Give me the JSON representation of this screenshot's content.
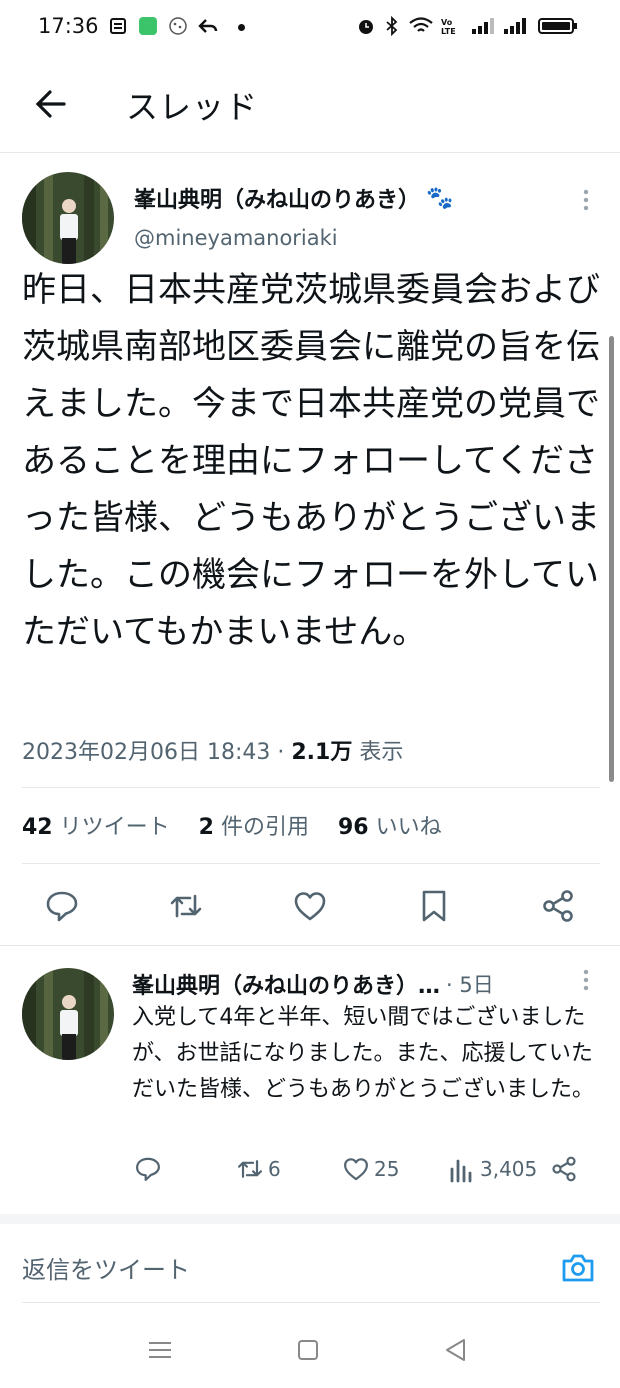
{
  "status_bar": {
    "time": "17:36"
  },
  "header": {
    "title": "スレッド"
  },
  "tweet": {
    "author_name": "峯山典明（みね山のりあき）",
    "author_handle": "@mineyamanoriaki",
    "paw_emoji": "🐾",
    "text": "昨日、日本共産党茨城県委員会および茨城県南部地区委員会に離党の旨を伝えました。今まで日本共産党の党員であることを理由にフォローしてくださった皆様、どうもありがとうございました。この機会にフォローを外していただいてもかまいません。",
    "datetime": "2023年02月06日 18:43",
    "separator": "·",
    "views_count": "2.1万",
    "views_label": "表示",
    "retweets_count": "42",
    "retweets_label": "リツイート",
    "quotes_count": "2",
    "quotes_label": "件の引用",
    "likes_count": "96",
    "likes_label": "いいね"
  },
  "reply": {
    "author_name": "峯山典明（みね山のりあき）…",
    "age": "· 5日",
    "text": "入党して4年と半年、短い間ではございましたが、お世話になりました。また、応援していただいた皆様、どうもありがとうございました。",
    "retweet_count": "6",
    "like_count": "25",
    "view_count": "3,405"
  },
  "compose": {
    "placeholder": "返信をツイート"
  },
  "colors": {
    "accent": "#1d9bf0",
    "secondary_text": "#536471",
    "divider": "#e6e9ea"
  }
}
